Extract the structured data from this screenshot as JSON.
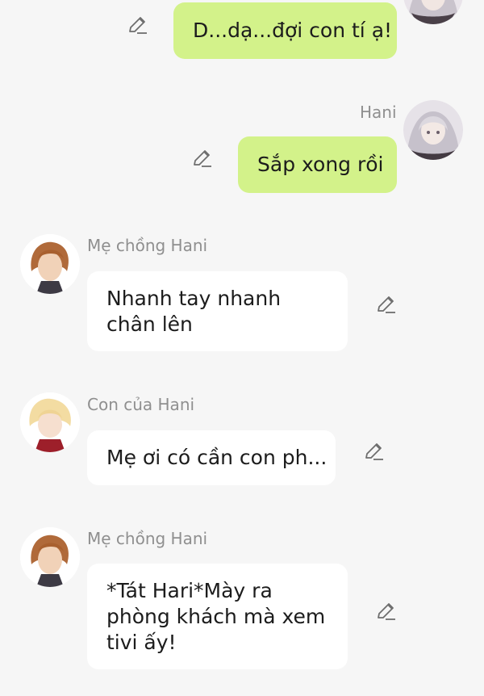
{
  "messages": [
    {
      "id": "m1",
      "side": "right",
      "sender": "",
      "text": "D...dạ...đợi con tí ạ!",
      "avatar": "hani-avatar"
    },
    {
      "id": "m2",
      "side": "right",
      "sender": "Hani",
      "text": "Sắp xong rồi",
      "avatar": "hani-avatar"
    },
    {
      "id": "m3",
      "side": "left",
      "sender": "Mẹ chồng Hani",
      "text": "Nhanh tay nhanh chân lên",
      "avatar": "mother-in-law-avatar"
    },
    {
      "id": "m4",
      "side": "left",
      "sender": "Con của Hani",
      "text": "Mẹ ơi có cần con ph...",
      "avatar": "child-avatar"
    },
    {
      "id": "m5",
      "side": "left",
      "sender": "Mẹ chồng Hani",
      "text": "*Tát Hari*Mày ra phòng khách mà xem tivi ấy!",
      "avatar": "mother-in-law-avatar"
    }
  ],
  "icons": {
    "edit": "pencil-edit-icon"
  },
  "colors": {
    "background": "#f6f6f6",
    "my_bubble": "#d3f28a",
    "their_bubble": "#ffffff",
    "sender_name": "#8f8f8f",
    "icon": "#6e6e6e"
  }
}
